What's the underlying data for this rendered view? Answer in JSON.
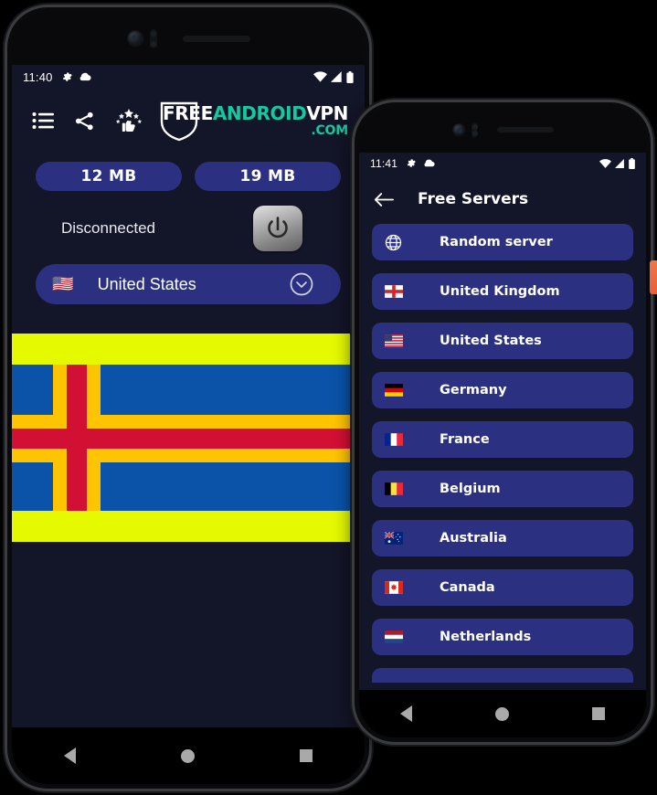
{
  "phone_main": {
    "status_bar": {
      "time": "11:40",
      "left_icons": [
        "gear-icon",
        "cloud-icon"
      ],
      "right_icons": [
        "wifi-icon",
        "signal-icon",
        "battery-icon"
      ]
    },
    "app_bar": {
      "icons": [
        "menu-list-icon",
        "share-icon",
        "rate-thumbs-up-icon"
      ],
      "logo": {
        "part1": "FREE",
        "part2": "ANDROID",
        "part3": "VPN",
        "part4": ".COM",
        "accent_color": "#14c8a0",
        "shield_icon": "shield-outline-icon"
      }
    },
    "usage": {
      "download_label": "12 MB",
      "upload_label": "19 MB",
      "pill_color": "#2b3180"
    },
    "connection": {
      "status_text": "Disconnected",
      "power_button": "power-icon"
    },
    "country_selector": {
      "flag": "🇺🇸",
      "name": "United States",
      "chevron": "chevron-down-icon"
    },
    "banner": {
      "type": "aland-islands-flag",
      "band_color": "#e5fa00",
      "field_color": "#0a53a8",
      "cross_outer_color": "#ffc400",
      "cross_inner_color": "#d21034"
    },
    "nav_bar": {
      "back": "nav-back-icon",
      "home": "nav-home-icon",
      "recents": "nav-recents-icon"
    }
  },
  "phone_secondary": {
    "status_bar": {
      "time": "11:41",
      "left_icons": [
        "gear-icon",
        "cloud-icon"
      ],
      "right_icons": [
        "wifi-icon",
        "signal-icon",
        "battery-icon"
      ]
    },
    "app_bar": {
      "back": "back-arrow-icon",
      "title": "Free Servers"
    },
    "servers": [
      {
        "flag": "globe",
        "name": "Random server"
      },
      {
        "flag": "🏴󠁧󠁢󠁥󠁮󠁧󠁿",
        "name": "United Kingdom"
      },
      {
        "flag": "🇺🇸",
        "name": "United States"
      },
      {
        "flag": "🇩🇪",
        "name": "Germany"
      },
      {
        "flag": "🇫🇷",
        "name": "France"
      },
      {
        "flag": "🇧🇪",
        "name": "Belgium"
      },
      {
        "flag": "🇦🇺",
        "name": "Australia"
      },
      {
        "flag": "🇨🇦",
        "name": "Canada"
      },
      {
        "flag": "🇳🇱",
        "name": "Netherlands"
      }
    ],
    "nav_bar": {
      "back": "nav-back-icon",
      "home": "nav-home-icon",
      "recents": "nav-recents-icon"
    }
  }
}
